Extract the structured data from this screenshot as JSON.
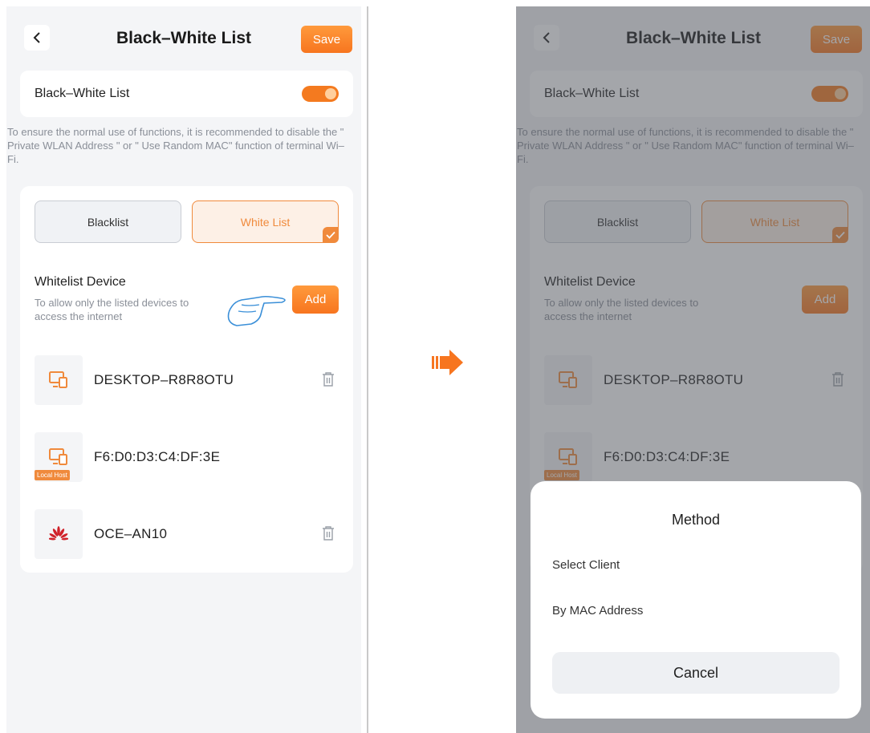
{
  "colors": {
    "accent": "#f7751f",
    "accent_light": "#fdf0e6",
    "background": "#f4f5f7",
    "overlay": "rgba(80,84,92,0.52)"
  },
  "screen": {
    "title": "Black–White List",
    "save_label": "Save",
    "toggle": {
      "label": "Black–White List",
      "enabled": true
    },
    "tip": "To ensure the normal use of functions, it is recommended to disable the \" Private WLAN Address \" or \" Use Random MAC\" function of terminal Wi–Fi.",
    "tabs": [
      {
        "label": "Blacklist",
        "selected": false
      },
      {
        "label": "White List",
        "selected": true
      }
    ],
    "whitelist": {
      "title": "Whitelist Device",
      "description": "To allow only the listed devices to access the internet",
      "add_label": "Add"
    },
    "devices": [
      {
        "name": "DESKTOP–R8R8OTU",
        "icon": "computer-icon",
        "badge": "",
        "deletable": true
      },
      {
        "name": "F6:D0:D3:C4:DF:3E",
        "icon": "computer-icon",
        "badge": "Local Host",
        "deletable": false
      },
      {
        "name": "OCE–AN10",
        "icon": "huawei-logo-icon",
        "badge": "",
        "deletable": true
      }
    ]
  },
  "sheet": {
    "title": "Method",
    "options": [
      "Select Client",
      "By MAC Address"
    ],
    "cancel_label": "Cancel"
  }
}
